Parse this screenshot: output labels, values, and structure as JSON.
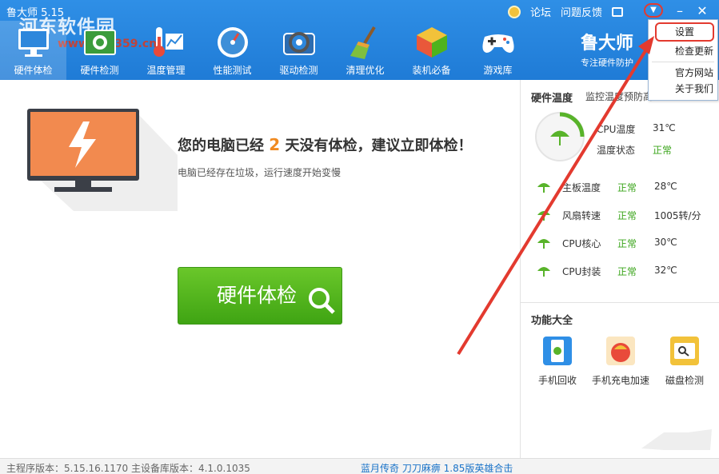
{
  "window": {
    "title": "鲁大师 5.15",
    "links": [
      "论坛",
      "问题反馈"
    ],
    "minimize": "–",
    "close": "✕",
    "menu_icon": "menu-down-icon"
  },
  "watermark": {
    "text": "河东软件园",
    "url": "www.pc0359.cn"
  },
  "nav": [
    {
      "label": "硬件体检",
      "icon": "monitor-icon"
    },
    {
      "label": "硬件检测",
      "icon": "chip-icon"
    },
    {
      "label": "温度管理",
      "icon": "thermometer-icon"
    },
    {
      "label": "性能测试",
      "icon": "speedometer-icon"
    },
    {
      "label": "驱动检测",
      "icon": "gear-icon"
    },
    {
      "label": "清理优化",
      "icon": "broom-icon"
    },
    {
      "label": "装机必备",
      "icon": "cube-icon"
    },
    {
      "label": "游戏库",
      "icon": "gamepad-icon"
    }
  ],
  "brand": {
    "name": "鲁大师",
    "subtitle": "专注硬件防护"
  },
  "dropdown": [
    "设置",
    "检查更新",
    "官方网站",
    "关于我们"
  ],
  "main": {
    "msg_prefix": "您的电脑已经",
    "days": "2",
    "msg_suffix": "天没有体检，建议立即体检！",
    "sub": "电脑已经存在垃圾，运行速度开始变慢",
    "button": "硬件体检"
  },
  "temp_panel": {
    "title": "硬件温度",
    "subtitle": "监控温度预防高",
    "cpu_label": "CPU温度",
    "cpu_value": "31℃",
    "status_label": "温度状态",
    "status_value": "正常",
    "rows": [
      {
        "label": "主板温度",
        "status": "正常",
        "value": "28℃"
      },
      {
        "label": "风扇转速",
        "status": "正常",
        "value": "1005转/分"
      },
      {
        "label": "CPU核心",
        "status": "正常",
        "value": "30℃"
      },
      {
        "label": "CPU封装",
        "status": "正常",
        "value": "32℃"
      }
    ]
  },
  "functions": {
    "title": "功能大全",
    "items": [
      {
        "label": "手机回收",
        "icon": "phone-recycle-icon"
      },
      {
        "label": "手机充电加速",
        "icon": "charge-boost-icon"
      },
      {
        "label": "磁盘检测",
        "icon": "disk-check-icon"
      }
    ]
  },
  "statusbar": {
    "version": "主程序版本：5.15.16.1170   主设备库版本：4.1.0.1035",
    "ad": "蓝月传奇 刀刀麻痹 1.85版英雄合击"
  },
  "colors": {
    "header": "#2482dc",
    "accent_green": "#4fb31c",
    "days_orange": "#f08a21",
    "annotation_red": "#e33a2f"
  }
}
